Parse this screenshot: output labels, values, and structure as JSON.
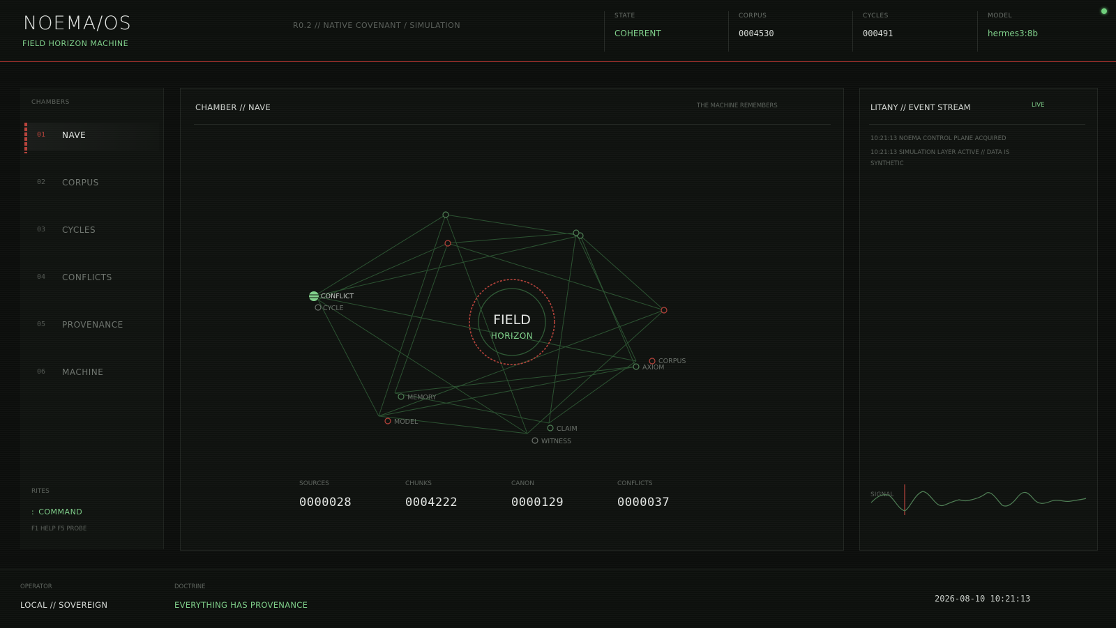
{
  "header": {
    "title": "NOEMA/OS",
    "subtitle": "FIELD HORIZON MACHINE",
    "version": "R0.2 // NATIVE COVENANT  /  SIMULATION",
    "stats": [
      {
        "label": "STATE",
        "value": "COHERENT"
      },
      {
        "label": "CORPUS",
        "value": "0004530"
      },
      {
        "label": "CYCLES",
        "value": "000491"
      },
      {
        "label": "MODEL",
        "value": "hermes3:8b"
      }
    ]
  },
  "sidebar": {
    "title": "CHAMBERS",
    "items": [
      {
        "num": "01",
        "label": "NAVE",
        "active": true
      },
      {
        "num": "02",
        "label": "CORPUS"
      },
      {
        "num": "03",
        "label": "CYCLES"
      },
      {
        "num": "04",
        "label": "CONFLICTS"
      },
      {
        "num": "05",
        "label": "PROVENANCE"
      },
      {
        "num": "06",
        "label": "MACHINE"
      }
    ],
    "rites_title": "RITES",
    "command_caret": ":",
    "command_label": "COMMAND",
    "hint": "F1 HELP  F5 PROBE"
  },
  "main": {
    "title": "CHAMBER // NAVE",
    "right_label": "THE MACHINE REMEMBERS",
    "center_title": "FIELD",
    "center_sub": "HORIZON",
    "nodes": [
      {
        "label": "CONFLICT",
        "color": "#7fcf8a"
      },
      {
        "label": "CYCLE",
        "color": "#6a706a"
      },
      {
        "label": "CORPUS",
        "color": "#b8433b"
      },
      {
        "label": "AXIOM",
        "color": "#4f7f55"
      },
      {
        "label": "MEMORY",
        "color": "#4f7f55"
      },
      {
        "label": "MODEL",
        "color": "#b8433b"
      },
      {
        "label": "CLAIM",
        "color": "#4f7f55"
      },
      {
        "label": "WITNESS",
        "color": "#6a706a"
      }
    ],
    "metrics": [
      {
        "label": "SOURCES",
        "value": "0000028"
      },
      {
        "label": "CHUNKS",
        "value": "0004222"
      },
      {
        "label": "CANON",
        "value": "0000129"
      },
      {
        "label": "CONFLICTS",
        "value": "0000037"
      }
    ]
  },
  "litany": {
    "title": "LITANY // EVENT STREAM",
    "live": "LIVE",
    "events": [
      "10:21:13  NOEMA CONTROL PLANE ACQUIRED",
      "10:21:13  SIMULATION LAYER ACTIVE // DATA IS SYNTHETIC"
    ],
    "signal_label": "SIGNAL"
  },
  "footer": {
    "operator_label": "OPERATOR",
    "operator_value": "LOCAL // SOVEREIGN",
    "doctrine_label": "DOCTRINE",
    "doctrine_value": "EVERYTHING HAS PROVENANCE",
    "timestamp": "2026-08-10  10:21:13"
  },
  "colors": {
    "accent_green": "#7fcf8a",
    "accent_red": "#b8433b",
    "background": "#0c0e0c"
  }
}
